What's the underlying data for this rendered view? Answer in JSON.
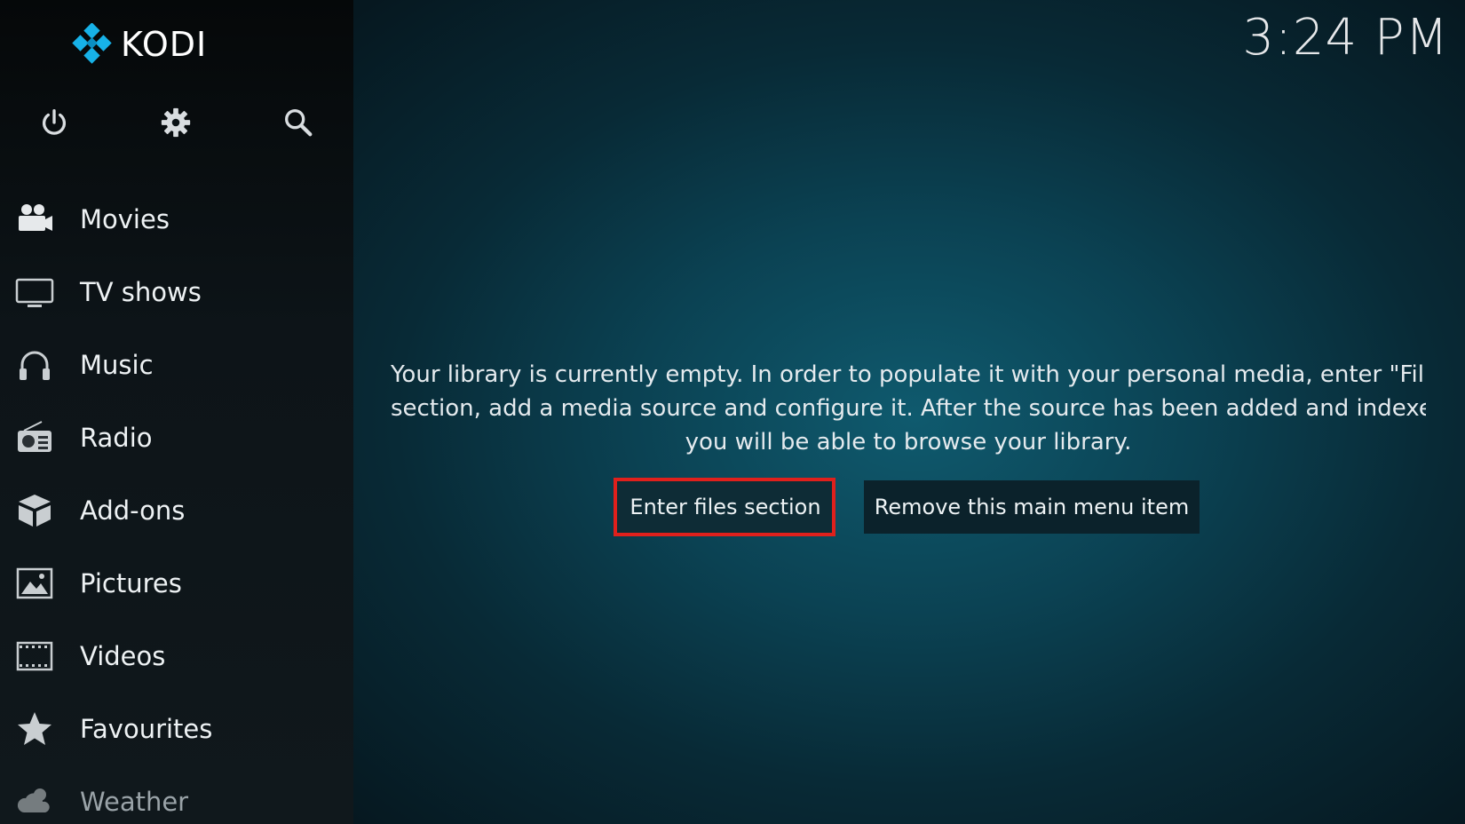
{
  "app": {
    "name": "KODI"
  },
  "clock": "3:24 PM",
  "top_icons": [
    {
      "name": "power-icon"
    },
    {
      "name": "settings-icon"
    },
    {
      "name": "search-icon"
    }
  ],
  "menu": [
    {
      "label": "Movies",
      "icon": "movie-camera-icon"
    },
    {
      "label": "TV shows",
      "icon": "tv-icon"
    },
    {
      "label": "Music",
      "icon": "headphones-icon"
    },
    {
      "label": "Radio",
      "icon": "radio-icon"
    },
    {
      "label": "Add-ons",
      "icon": "addons-box-icon"
    },
    {
      "label": "Pictures",
      "icon": "picture-icon"
    },
    {
      "label": "Videos",
      "icon": "film-strip-icon"
    },
    {
      "label": "Favourites",
      "icon": "star-icon"
    },
    {
      "label": "Weather",
      "icon": "weather-cloud-icon"
    }
  ],
  "message": {
    "line1": "Your library is currently empty. In order to populate it with your personal media, enter \"Fil",
    "line2": "section, add a media source and configure it. After the source has been added and indexe",
    "line3": "you will be able to browse your library."
  },
  "buttons": {
    "enter_files": "Enter files section",
    "remove_item": "Remove this main menu item"
  },
  "colors": {
    "highlight_border": "#e0201c",
    "background_accent": "#0f5a6e",
    "logo_blue": "#17b2e8"
  }
}
